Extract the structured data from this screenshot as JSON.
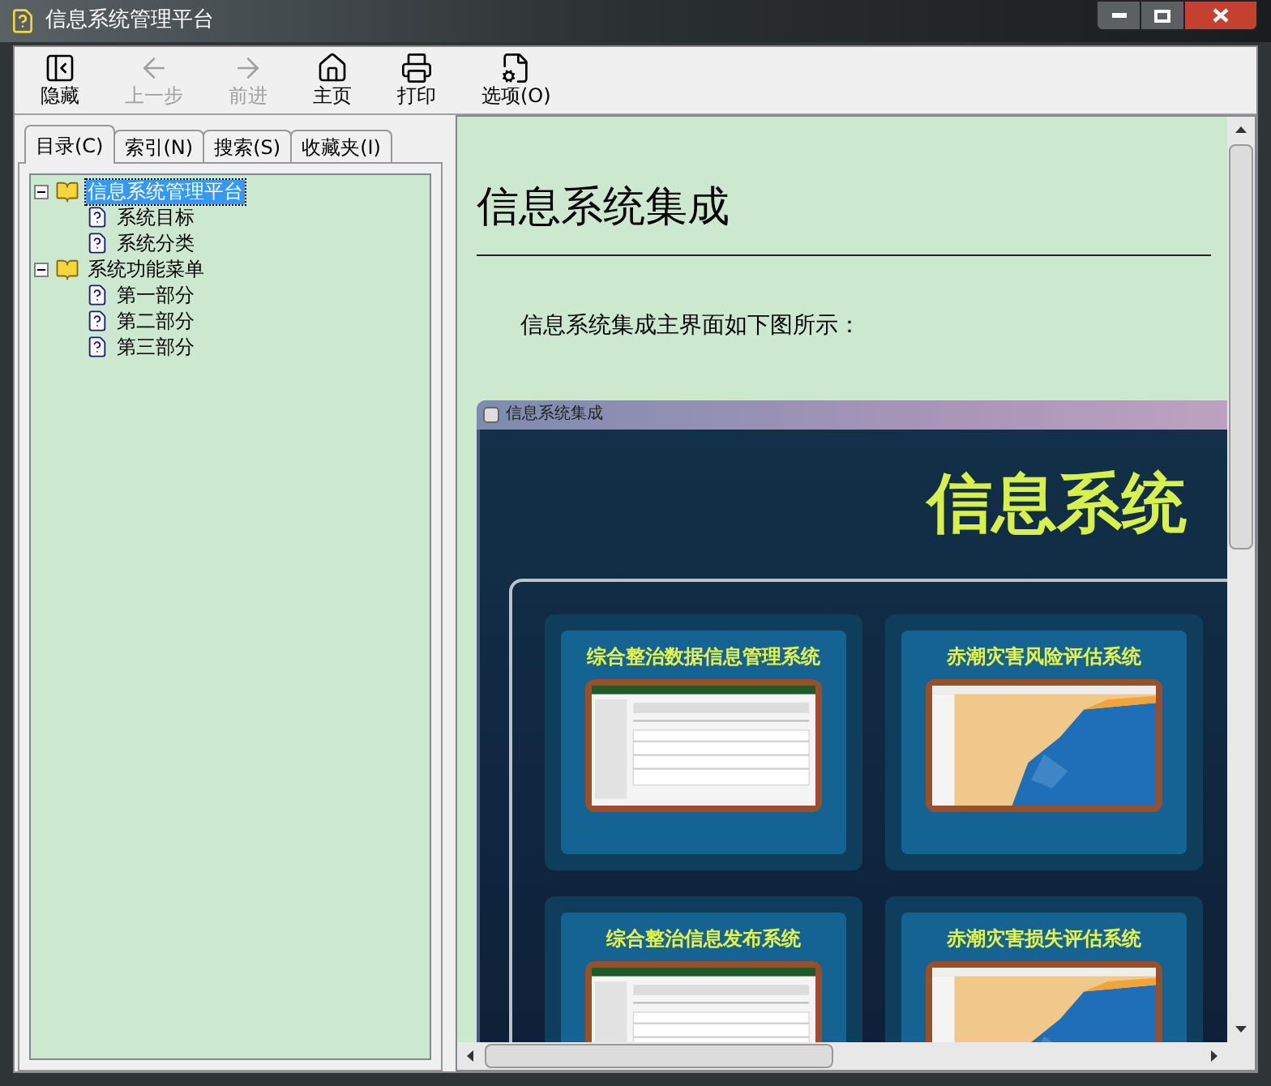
{
  "window": {
    "title": "信息系统管理平台"
  },
  "toolbar": [
    {
      "label": "隐藏",
      "kind": "hide",
      "disabled": false
    },
    {
      "label": "上一步",
      "kind": "back",
      "disabled": true
    },
    {
      "label": "前进",
      "kind": "forward",
      "disabled": true
    },
    {
      "label": "主页",
      "kind": "home",
      "disabled": false
    },
    {
      "label": "打印",
      "kind": "print",
      "disabled": false
    },
    {
      "label": "选项(O)",
      "kind": "options",
      "disabled": false
    }
  ],
  "tabs": [
    {
      "label": "目录(C)",
      "selected": true
    },
    {
      "label": "索引(N)",
      "selected": false
    },
    {
      "label": "搜索(S)",
      "selected": false
    },
    {
      "label": "收藏夹(I)",
      "selected": false
    }
  ],
  "tree": [
    {
      "label": "信息系统管理平台",
      "kind": "book",
      "expanded": true,
      "selected": true,
      "children": [
        {
          "label": "系统目标",
          "kind": "topic",
          "selected": false
        },
        {
          "label": "系统分类",
          "kind": "topic",
          "selected": false
        }
      ]
    },
    {
      "label": "系统功能菜单",
      "kind": "book",
      "expanded": true,
      "selected": false,
      "children": [
        {
          "label": "第一部分",
          "kind": "topic",
          "selected": false
        },
        {
          "label": "第二部分",
          "kind": "topic",
          "selected": false
        },
        {
          "label": "第三部分",
          "kind": "topic",
          "selected": false
        }
      ]
    }
  ],
  "content": {
    "heading": "信息系统集成",
    "paragraph": "信息系统集成主界面如下图所示：",
    "screenshot": {
      "title": "信息系统集成",
      "banner": "信息系统",
      "cards": [
        {
          "title": "综合整治数据信息管理系统"
        },
        {
          "title": "赤潮灾害风险评估系统"
        },
        {
          "title": "综合整治信息发布系统"
        },
        {
          "title": "赤潮灾害损失评估系统"
        }
      ]
    }
  }
}
